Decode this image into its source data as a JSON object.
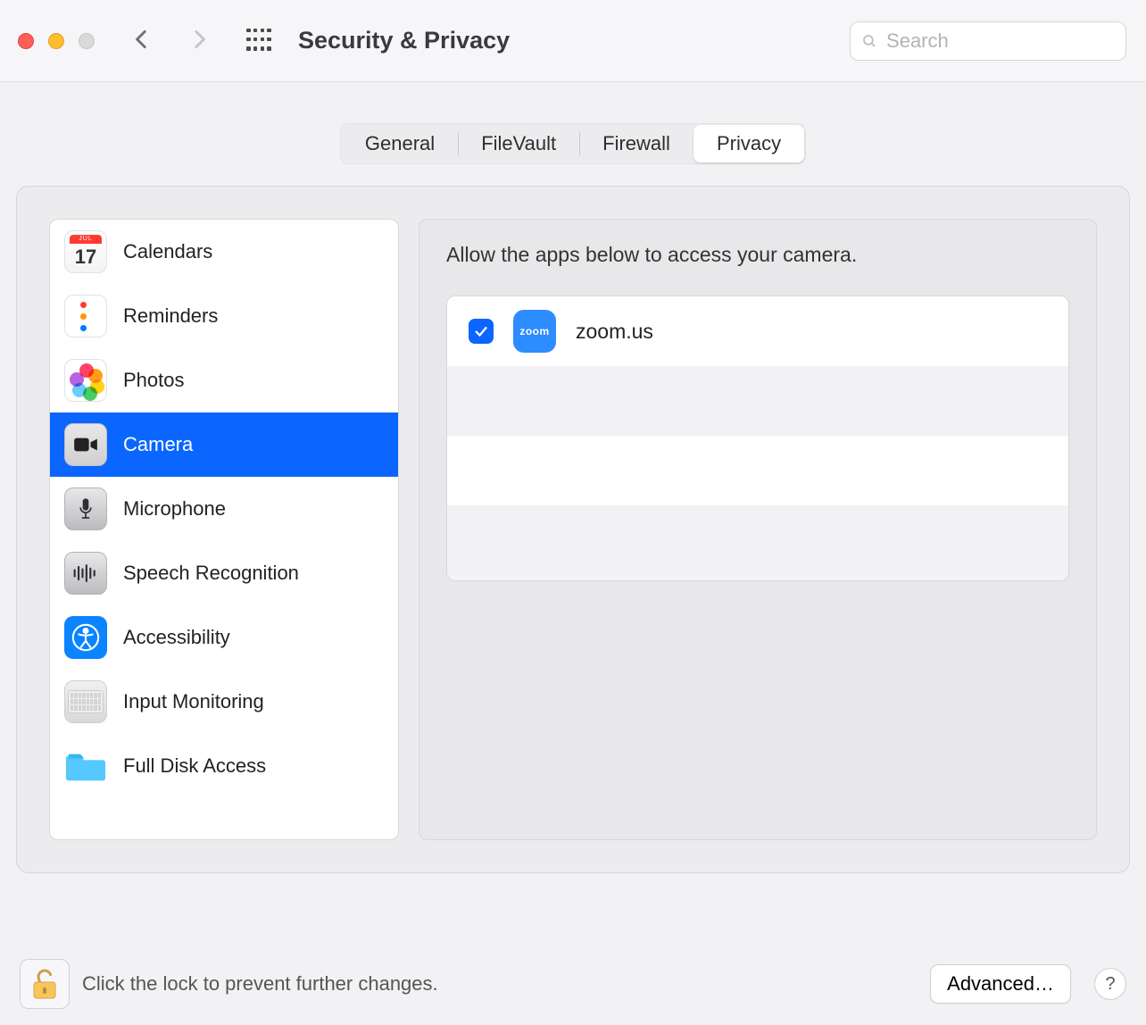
{
  "window": {
    "title": "Security & Privacy",
    "search_placeholder": "Search"
  },
  "tabs": {
    "items": [
      {
        "label": "General",
        "active": false
      },
      {
        "label": "FileVault",
        "active": false
      },
      {
        "label": "Firewall",
        "active": false
      },
      {
        "label": "Privacy",
        "active": true
      }
    ]
  },
  "sidebar": {
    "items": [
      {
        "label": "Calendars",
        "selected": false,
        "icon": "calendar-icon"
      },
      {
        "label": "Reminders",
        "selected": false,
        "icon": "reminders-icon"
      },
      {
        "label": "Photos",
        "selected": false,
        "icon": "photos-icon"
      },
      {
        "label": "Camera",
        "selected": true,
        "icon": "camera-icon"
      },
      {
        "label": "Microphone",
        "selected": false,
        "icon": "microphone-icon"
      },
      {
        "label": "Speech Recognition",
        "selected": false,
        "icon": "speech-icon"
      },
      {
        "label": "Accessibility",
        "selected": false,
        "icon": "accessibility-icon"
      },
      {
        "label": "Input Monitoring",
        "selected": false,
        "icon": "keyboard-icon"
      },
      {
        "label": "Full Disk Access",
        "selected": false,
        "icon": "folder-icon"
      }
    ]
  },
  "detail": {
    "heading": "Allow the apps below to access your camera.",
    "apps": [
      {
        "name": "zoom.us",
        "checked": true,
        "icon_text": "zoom",
        "icon_bg": "#2D8CFF"
      }
    ]
  },
  "footer": {
    "lock_label": "Click the lock to prevent further changes.",
    "advanced_label": "Advanced…",
    "help_label": "?"
  },
  "calendar_icon": {
    "month": "JUL",
    "day": "17"
  },
  "colors": {
    "selection": "#0a66ff",
    "accent": "#0a84ff"
  }
}
